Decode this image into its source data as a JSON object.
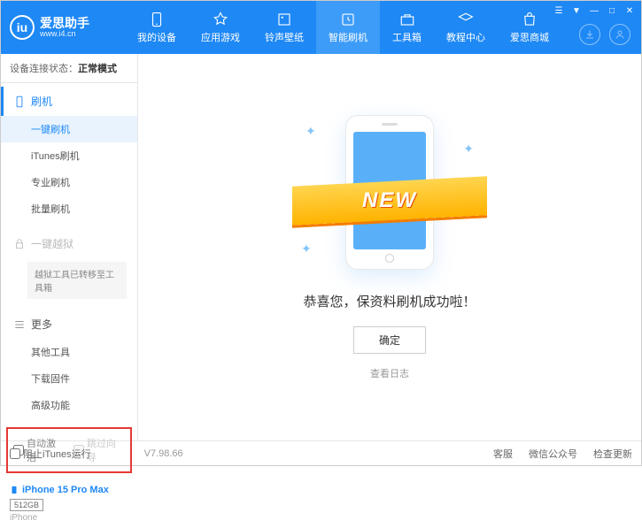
{
  "header": {
    "logo_text": "爱思助手",
    "logo_url": "www.i4.cn",
    "nav": [
      {
        "label": "我的设备"
      },
      {
        "label": "应用游戏"
      },
      {
        "label": "铃声壁纸"
      },
      {
        "label": "智能刷机"
      },
      {
        "label": "工具箱"
      },
      {
        "label": "教程中心"
      },
      {
        "label": "爱思商城"
      }
    ]
  },
  "sidebar": {
    "status_label": "设备连接状态：",
    "status_value": "正常模式",
    "sections": {
      "flash": {
        "header": "刷机",
        "items": [
          "一键刷机",
          "iTunes刷机",
          "专业刷机",
          "批量刷机"
        ]
      },
      "jailbreak": {
        "header": "一键越狱",
        "note": "越狱工具已转移至工具箱"
      },
      "more": {
        "header": "更多",
        "items": [
          "其他工具",
          "下载固件",
          "高级功能"
        ]
      }
    },
    "checkboxes": {
      "auto_activate": "自动激活",
      "skip_guide": "跳过向导"
    },
    "device": {
      "name": "iPhone 15 Pro Max",
      "storage": "512GB",
      "model": "iPhone"
    }
  },
  "main": {
    "ribbon": "NEW",
    "success_msg": "恭喜您，保资料刷机成功啦！",
    "confirm": "确定",
    "view_log": "查看日志"
  },
  "footer": {
    "block_itunes": "阻止iTunes运行",
    "version": "V7.98.66",
    "links": [
      "客服",
      "微信公众号",
      "检查更新"
    ]
  }
}
